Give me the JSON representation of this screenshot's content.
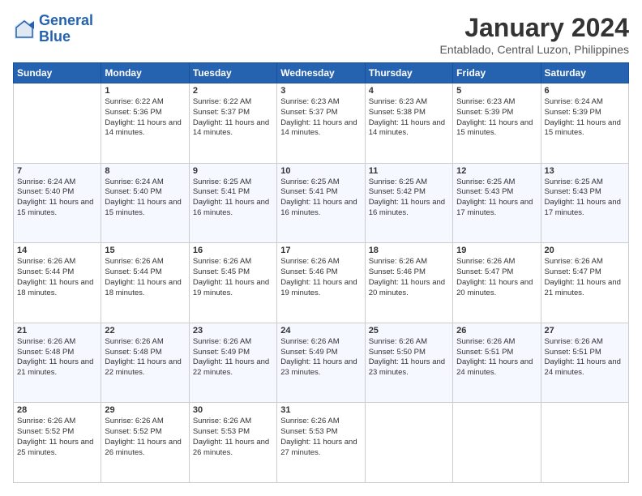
{
  "logo": {
    "line1": "General",
    "line2": "Blue"
  },
  "title": "January 2024",
  "subtitle": "Entablado, Central Luzon, Philippines",
  "weekdays": [
    "Sunday",
    "Monday",
    "Tuesday",
    "Wednesday",
    "Thursday",
    "Friday",
    "Saturday"
  ],
  "weeks": [
    [
      {
        "day": "",
        "sunrise": "",
        "sunset": "",
        "daylight": ""
      },
      {
        "day": "1",
        "sunrise": "Sunrise: 6:22 AM",
        "sunset": "Sunset: 5:36 PM",
        "daylight": "Daylight: 11 hours and 14 minutes."
      },
      {
        "day": "2",
        "sunrise": "Sunrise: 6:22 AM",
        "sunset": "Sunset: 5:37 PM",
        "daylight": "Daylight: 11 hours and 14 minutes."
      },
      {
        "day": "3",
        "sunrise": "Sunrise: 6:23 AM",
        "sunset": "Sunset: 5:37 PM",
        "daylight": "Daylight: 11 hours and 14 minutes."
      },
      {
        "day": "4",
        "sunrise": "Sunrise: 6:23 AM",
        "sunset": "Sunset: 5:38 PM",
        "daylight": "Daylight: 11 hours and 14 minutes."
      },
      {
        "day": "5",
        "sunrise": "Sunrise: 6:23 AM",
        "sunset": "Sunset: 5:39 PM",
        "daylight": "Daylight: 11 hours and 15 minutes."
      },
      {
        "day": "6",
        "sunrise": "Sunrise: 6:24 AM",
        "sunset": "Sunset: 5:39 PM",
        "daylight": "Daylight: 11 hours and 15 minutes."
      }
    ],
    [
      {
        "day": "7",
        "sunrise": "Sunrise: 6:24 AM",
        "sunset": "Sunset: 5:40 PM",
        "daylight": "Daylight: 11 hours and 15 minutes."
      },
      {
        "day": "8",
        "sunrise": "Sunrise: 6:24 AM",
        "sunset": "Sunset: 5:40 PM",
        "daylight": "Daylight: 11 hours and 15 minutes."
      },
      {
        "day": "9",
        "sunrise": "Sunrise: 6:25 AM",
        "sunset": "Sunset: 5:41 PM",
        "daylight": "Daylight: 11 hours and 16 minutes."
      },
      {
        "day": "10",
        "sunrise": "Sunrise: 6:25 AM",
        "sunset": "Sunset: 5:41 PM",
        "daylight": "Daylight: 11 hours and 16 minutes."
      },
      {
        "day": "11",
        "sunrise": "Sunrise: 6:25 AM",
        "sunset": "Sunset: 5:42 PM",
        "daylight": "Daylight: 11 hours and 16 minutes."
      },
      {
        "day": "12",
        "sunrise": "Sunrise: 6:25 AM",
        "sunset": "Sunset: 5:43 PM",
        "daylight": "Daylight: 11 hours and 17 minutes."
      },
      {
        "day": "13",
        "sunrise": "Sunrise: 6:25 AM",
        "sunset": "Sunset: 5:43 PM",
        "daylight": "Daylight: 11 hours and 17 minutes."
      }
    ],
    [
      {
        "day": "14",
        "sunrise": "Sunrise: 6:26 AM",
        "sunset": "Sunset: 5:44 PM",
        "daylight": "Daylight: 11 hours and 18 minutes."
      },
      {
        "day": "15",
        "sunrise": "Sunrise: 6:26 AM",
        "sunset": "Sunset: 5:44 PM",
        "daylight": "Daylight: 11 hours and 18 minutes."
      },
      {
        "day": "16",
        "sunrise": "Sunrise: 6:26 AM",
        "sunset": "Sunset: 5:45 PM",
        "daylight": "Daylight: 11 hours and 19 minutes."
      },
      {
        "day": "17",
        "sunrise": "Sunrise: 6:26 AM",
        "sunset": "Sunset: 5:46 PM",
        "daylight": "Daylight: 11 hours and 19 minutes."
      },
      {
        "day": "18",
        "sunrise": "Sunrise: 6:26 AM",
        "sunset": "Sunset: 5:46 PM",
        "daylight": "Daylight: 11 hours and 20 minutes."
      },
      {
        "day": "19",
        "sunrise": "Sunrise: 6:26 AM",
        "sunset": "Sunset: 5:47 PM",
        "daylight": "Daylight: 11 hours and 20 minutes."
      },
      {
        "day": "20",
        "sunrise": "Sunrise: 6:26 AM",
        "sunset": "Sunset: 5:47 PM",
        "daylight": "Daylight: 11 hours and 21 minutes."
      }
    ],
    [
      {
        "day": "21",
        "sunrise": "Sunrise: 6:26 AM",
        "sunset": "Sunset: 5:48 PM",
        "daylight": "Daylight: 11 hours and 21 minutes."
      },
      {
        "day": "22",
        "sunrise": "Sunrise: 6:26 AM",
        "sunset": "Sunset: 5:48 PM",
        "daylight": "Daylight: 11 hours and 22 minutes."
      },
      {
        "day": "23",
        "sunrise": "Sunrise: 6:26 AM",
        "sunset": "Sunset: 5:49 PM",
        "daylight": "Daylight: 11 hours and 22 minutes."
      },
      {
        "day": "24",
        "sunrise": "Sunrise: 6:26 AM",
        "sunset": "Sunset: 5:49 PM",
        "daylight": "Daylight: 11 hours and 23 minutes."
      },
      {
        "day": "25",
        "sunrise": "Sunrise: 6:26 AM",
        "sunset": "Sunset: 5:50 PM",
        "daylight": "Daylight: 11 hours and 23 minutes."
      },
      {
        "day": "26",
        "sunrise": "Sunrise: 6:26 AM",
        "sunset": "Sunset: 5:51 PM",
        "daylight": "Daylight: 11 hours and 24 minutes."
      },
      {
        "day": "27",
        "sunrise": "Sunrise: 6:26 AM",
        "sunset": "Sunset: 5:51 PM",
        "daylight": "Daylight: 11 hours and 24 minutes."
      }
    ],
    [
      {
        "day": "28",
        "sunrise": "Sunrise: 6:26 AM",
        "sunset": "Sunset: 5:52 PM",
        "daylight": "Daylight: 11 hours and 25 minutes."
      },
      {
        "day": "29",
        "sunrise": "Sunrise: 6:26 AM",
        "sunset": "Sunset: 5:52 PM",
        "daylight": "Daylight: 11 hours and 26 minutes."
      },
      {
        "day": "30",
        "sunrise": "Sunrise: 6:26 AM",
        "sunset": "Sunset: 5:53 PM",
        "daylight": "Daylight: 11 hours and 26 minutes."
      },
      {
        "day": "31",
        "sunrise": "Sunrise: 6:26 AM",
        "sunset": "Sunset: 5:53 PM",
        "daylight": "Daylight: 11 hours and 27 minutes."
      },
      {
        "day": "",
        "sunrise": "",
        "sunset": "",
        "daylight": ""
      },
      {
        "day": "",
        "sunrise": "",
        "sunset": "",
        "daylight": ""
      },
      {
        "day": "",
        "sunrise": "",
        "sunset": "",
        "daylight": ""
      }
    ]
  ]
}
